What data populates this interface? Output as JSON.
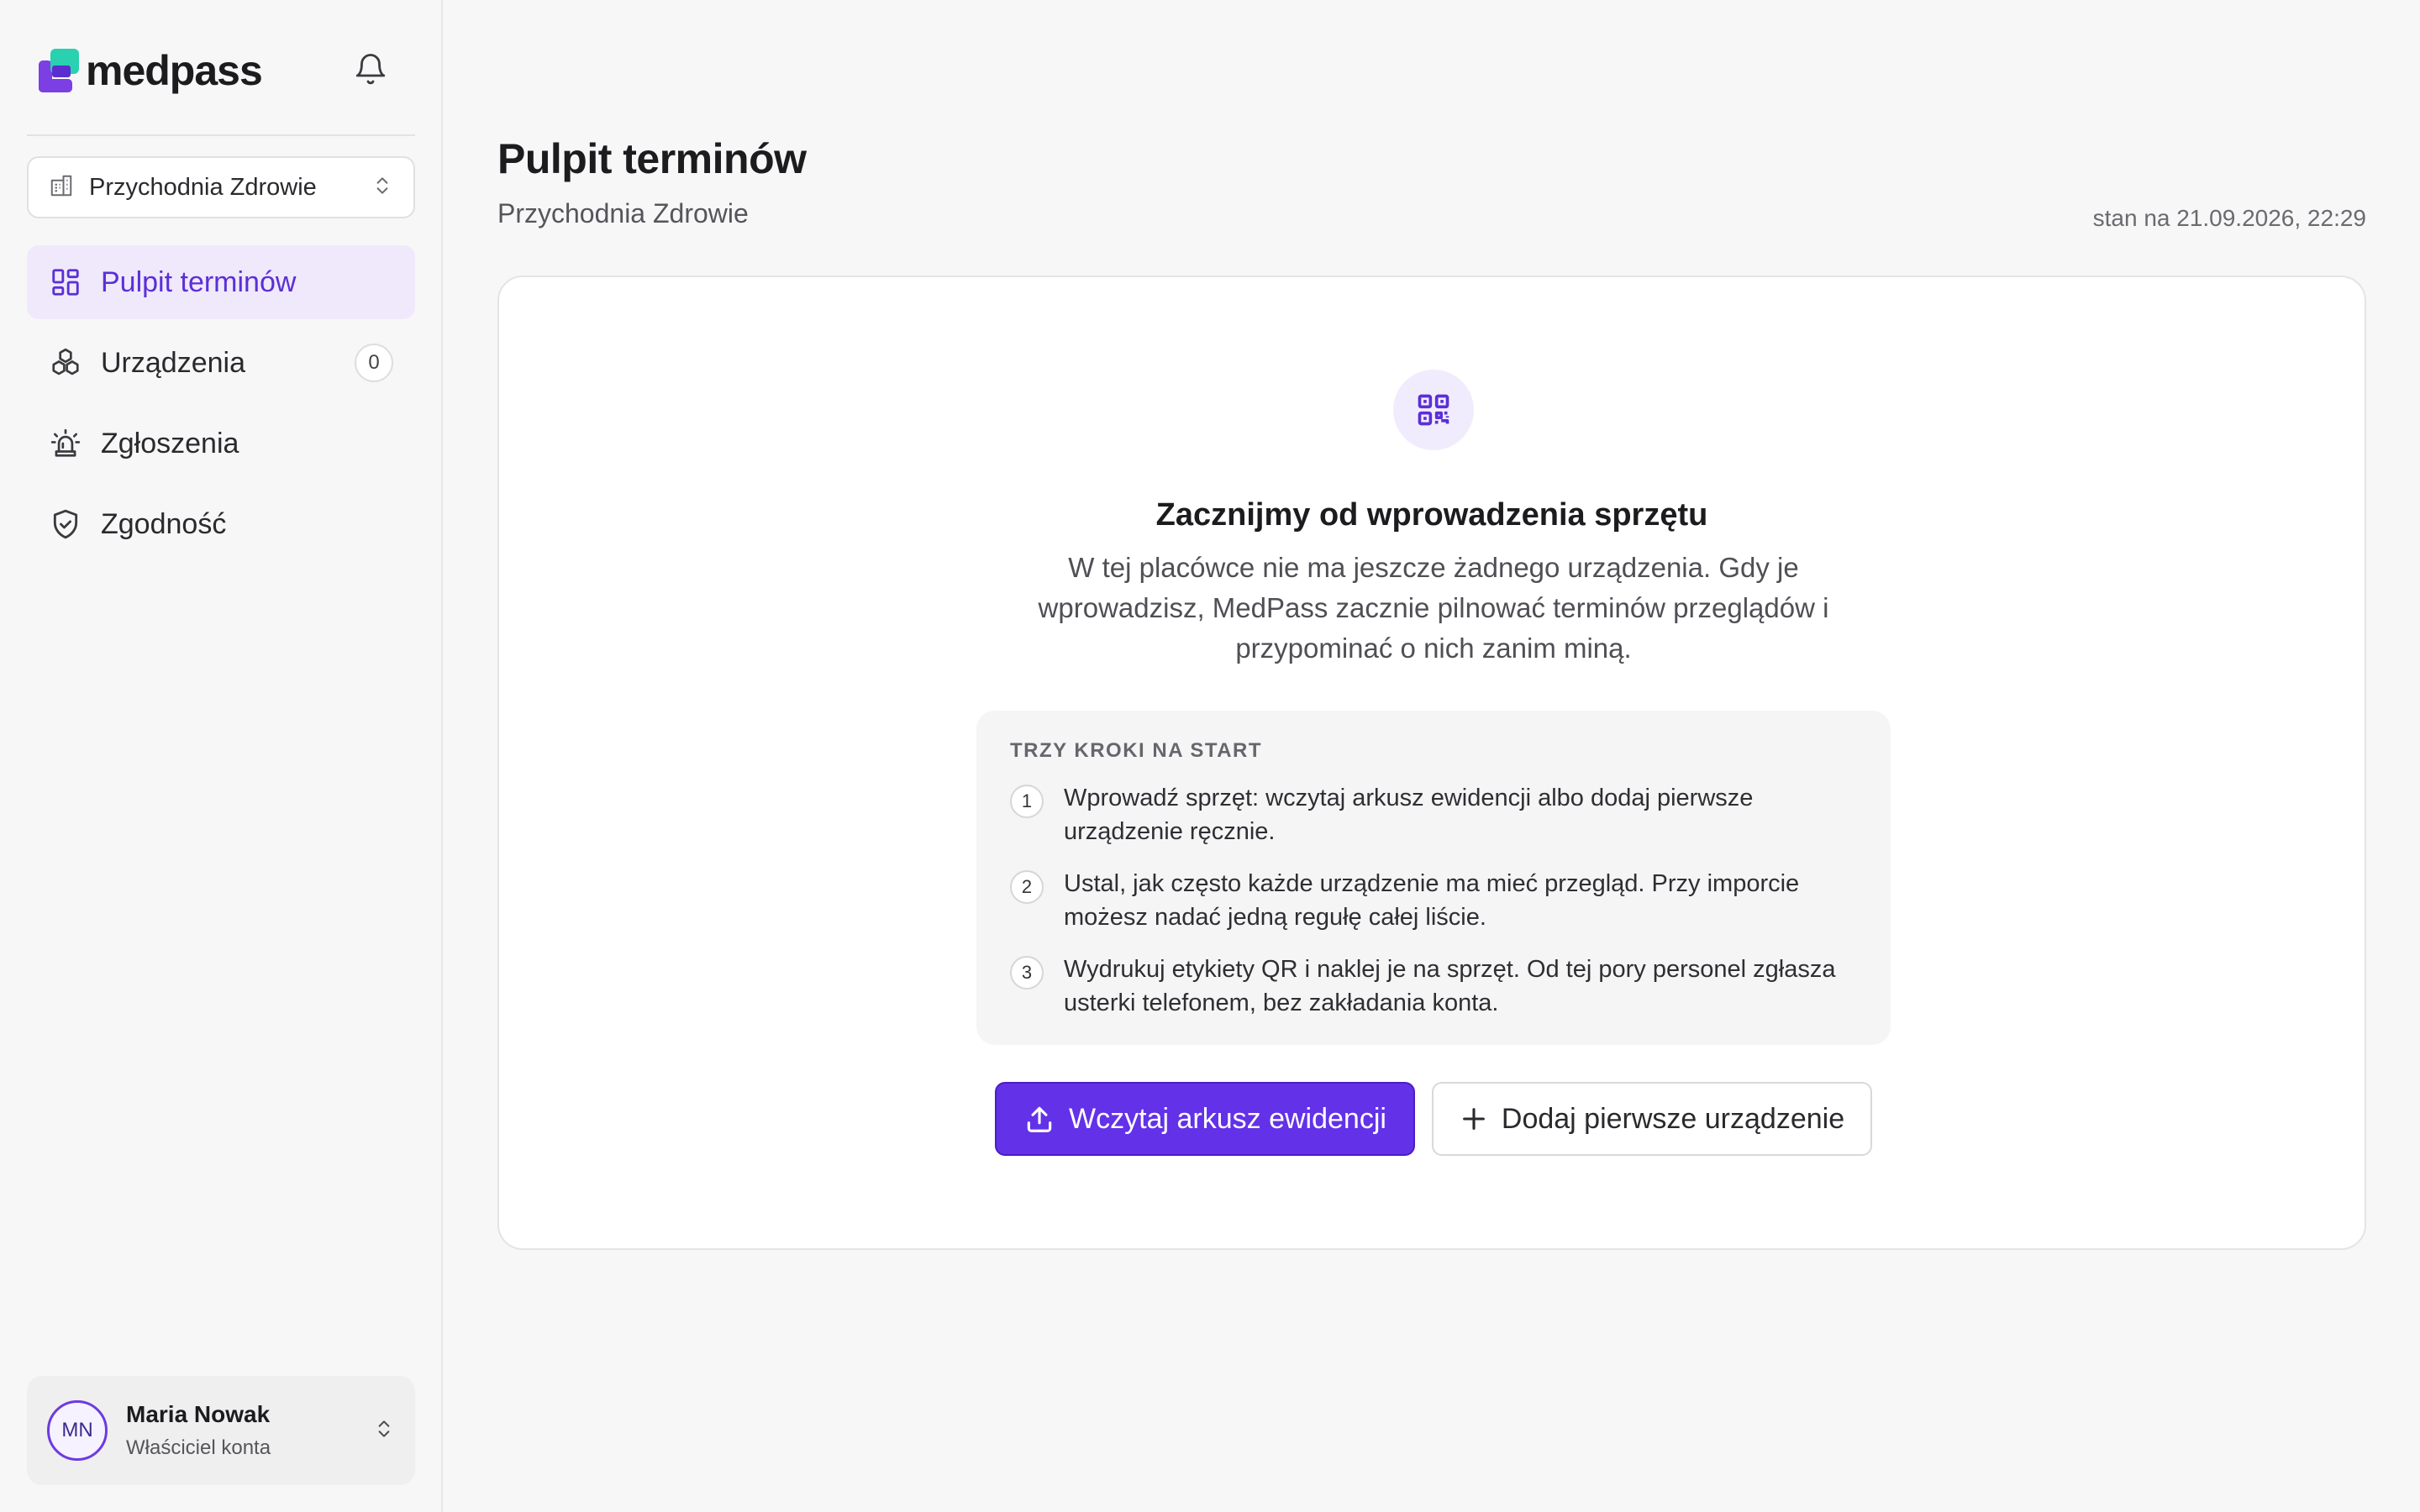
{
  "brand": {
    "name": "medpass"
  },
  "sidebar": {
    "clinic": "Przychodnia Zdrowie",
    "nav": [
      {
        "label": "Pulpit terminów",
        "icon": "dashboard-icon",
        "active": true
      },
      {
        "label": "Urządzenia",
        "icon": "devices-icon",
        "count": "0"
      },
      {
        "label": "Zgłoszenia",
        "icon": "siren-icon"
      },
      {
        "label": "Zgodność",
        "icon": "shield-check-icon"
      }
    ],
    "user": {
      "initials": "MN",
      "name": "Maria Nowak",
      "role": "Właściciel konta"
    }
  },
  "header": {
    "title": "Pulpit terminów",
    "subtitle": "Przychodnia Zdrowie",
    "timestamp": "stan na 21.09.2026, 22:29"
  },
  "empty_state": {
    "icon": "qr-code-icon",
    "title": "Zacznijmy od wprowadzenia sprzętu",
    "description": "W tej placówce nie ma jeszcze żadnego urządzenia. Gdy je wprowadzisz, MedPass zacznie pilnować terminów przeglądów i przypominać o nich zanim miną.",
    "steps_heading": "TRZY KROKI NA START",
    "steps": [
      {
        "num": "1",
        "text": "Wprowadź sprzęt: wczytaj arkusz ewidencji albo dodaj pierwsze urządzenie ręcznie."
      },
      {
        "num": "2",
        "text": "Ustal, jak często każde urządzenie ma mieć przegląd. Przy imporcie możesz nadać jedną regułę całej liście."
      },
      {
        "num": "3",
        "text": "Wydrukuj etykiety QR i naklej je na sprzęt. Od tej pory personel zgłasza usterki telefonem, bez zakładania konta."
      }
    ],
    "primary_button": "Wczytaj arkusz ewidencji",
    "secondary_button": "Dodaj pierwsze urządzenie"
  },
  "colors": {
    "accent": "#6331e8",
    "logo_purple": "#7b3fe4",
    "logo_teal": "#2ad1b0",
    "active_bg": "#efe9fb"
  }
}
